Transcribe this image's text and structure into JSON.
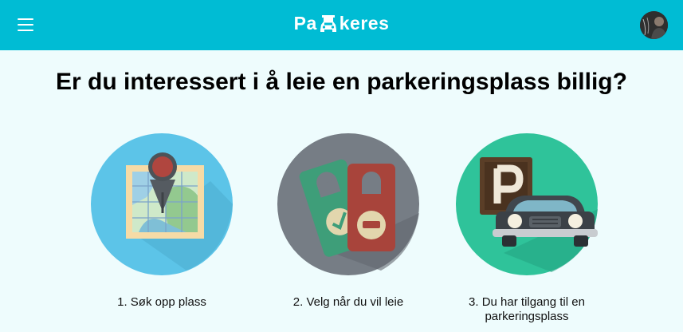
{
  "header": {
    "brand_left": "Pa",
    "brand_right": "keres",
    "logo_icon": "parking-car-icon",
    "menu_icon": "hamburger-menu-icon",
    "avatar_icon": "user-avatar"
  },
  "main": {
    "headline": "Er du interessert i å leie en parkeringsplass billig?",
    "steps": [
      {
        "caption": "1. Søk opp plass",
        "icon": "map-pin-icon",
        "color": "#5cc4e8"
      },
      {
        "caption": "2. Velg når du vil leie",
        "icon": "door-hanger-icon",
        "color": "#767d85"
      },
      {
        "caption": "3. Du har tilgang til en parkeringsplass",
        "icon": "parking-car-icon",
        "color": "#2fc39a"
      }
    ]
  },
  "colors": {
    "header": "#00bcd4",
    "background": "#eefcfd"
  }
}
